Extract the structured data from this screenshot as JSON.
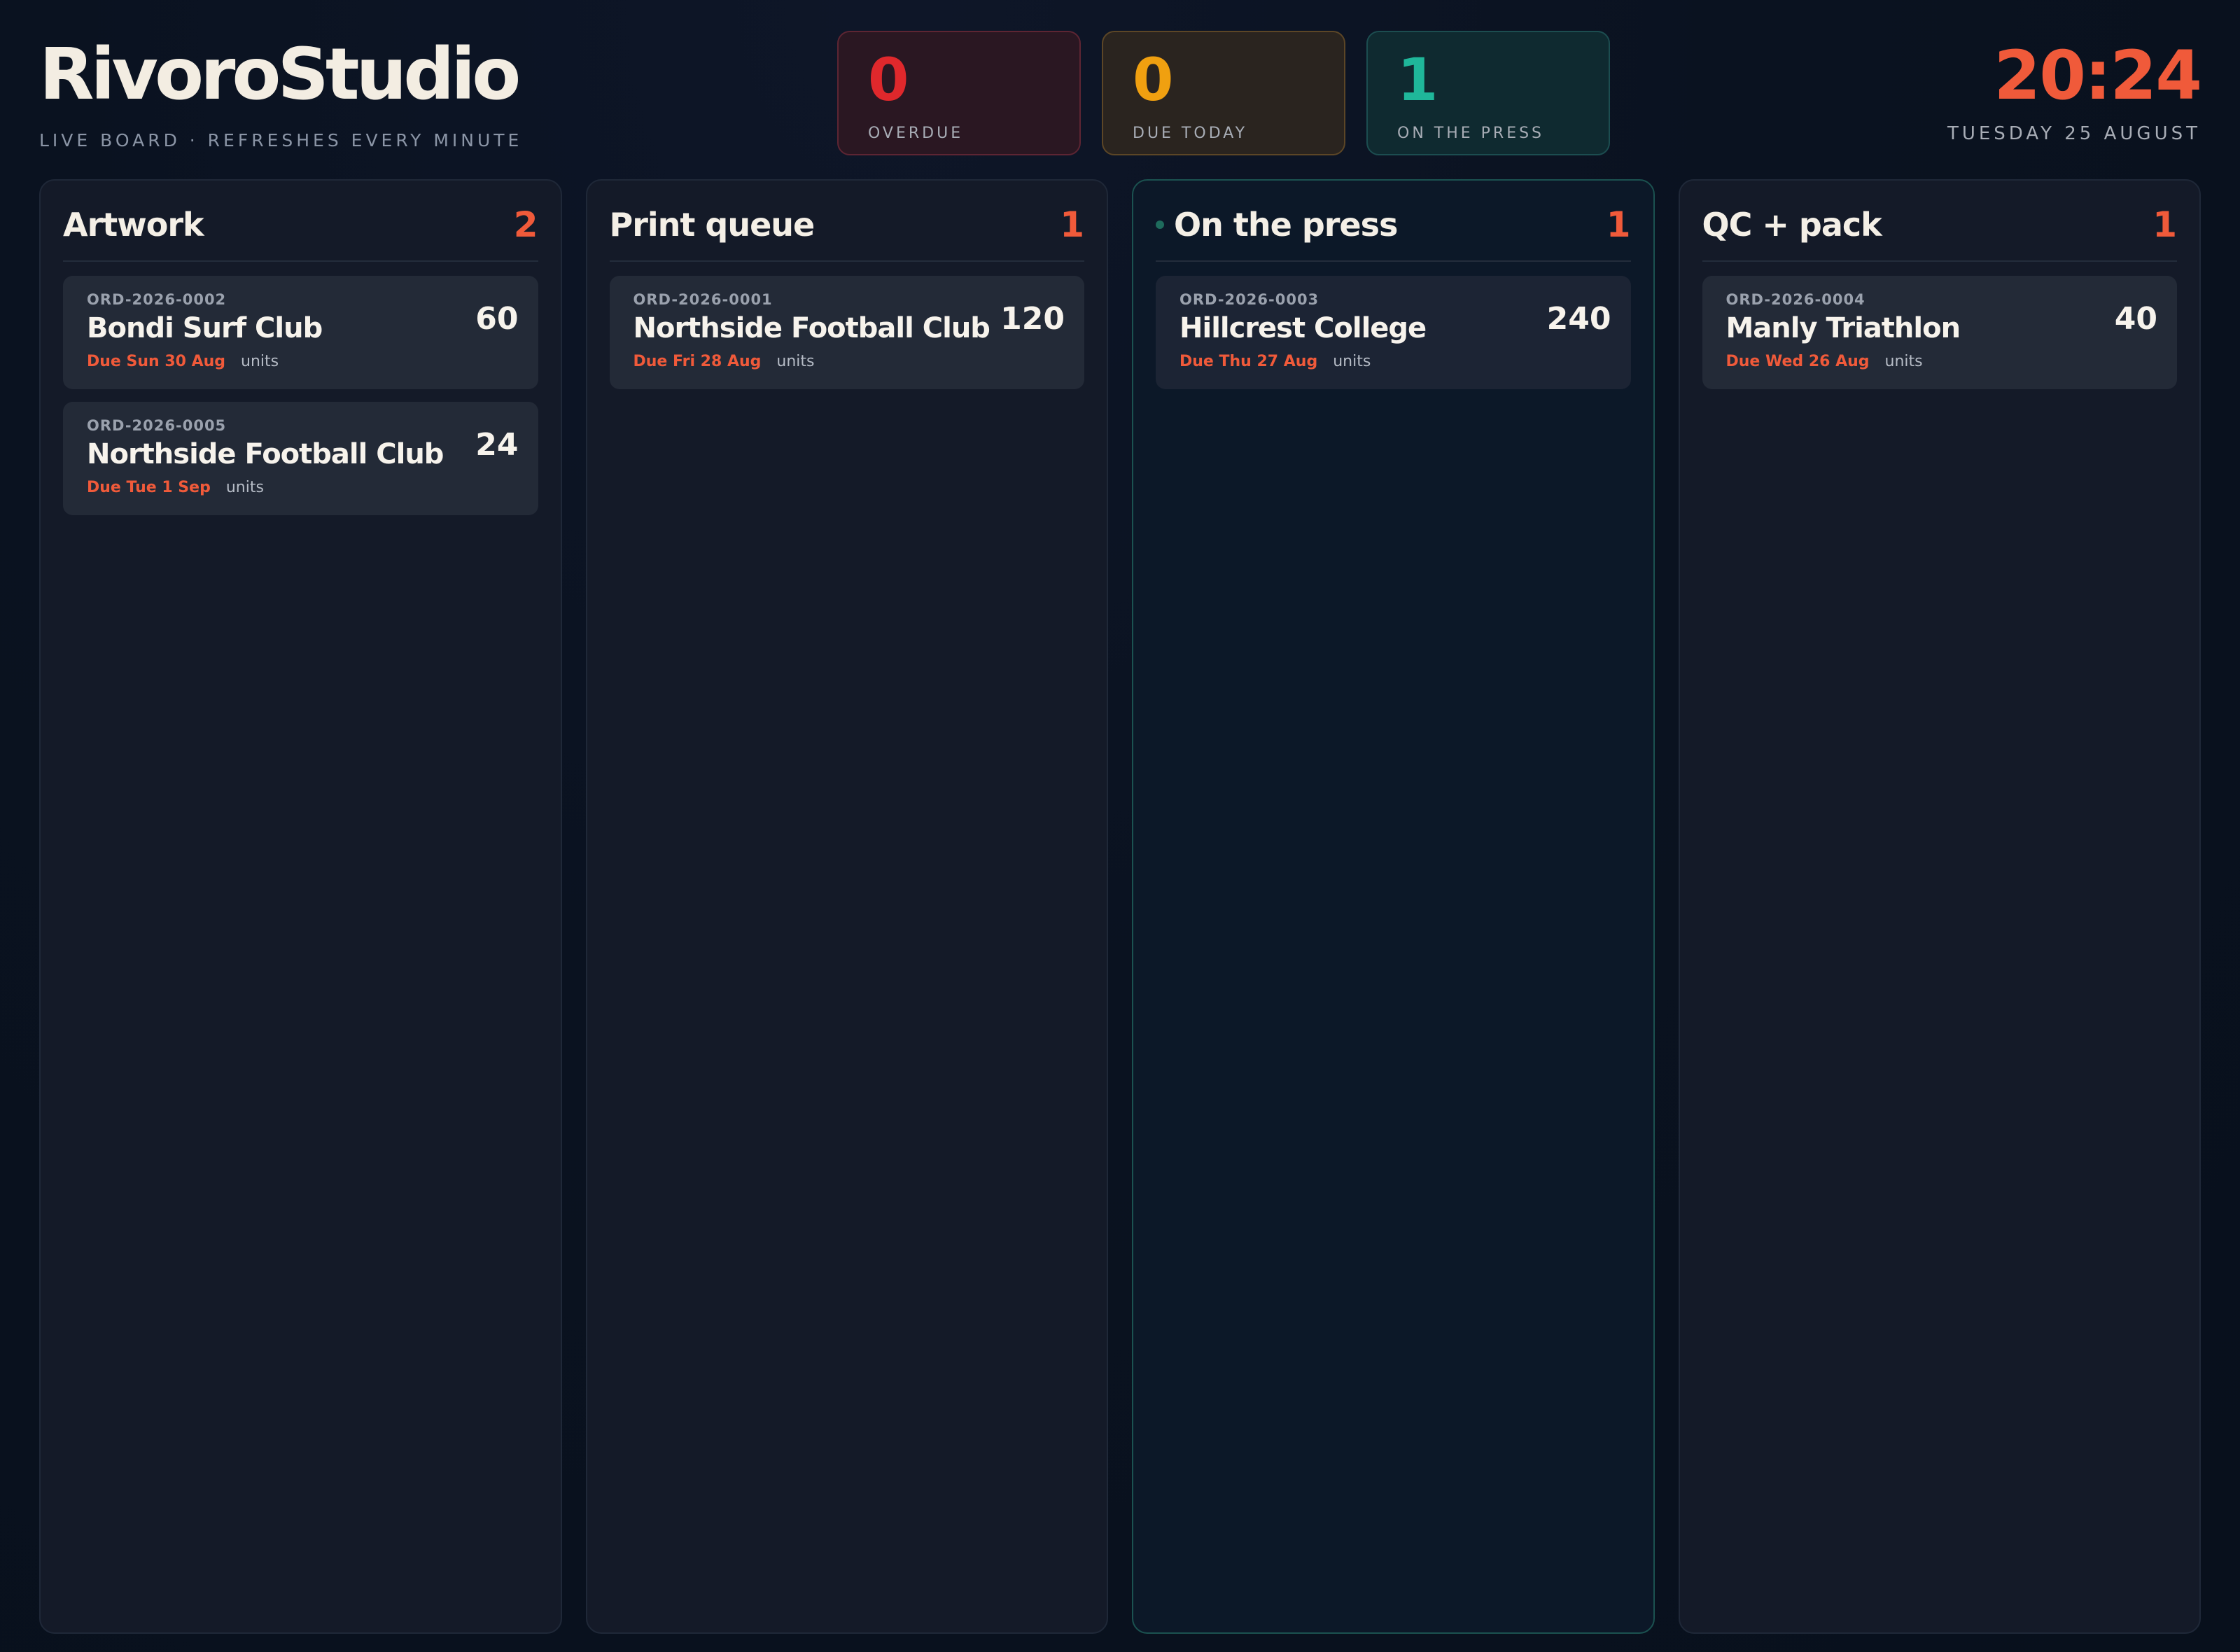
{
  "header": {
    "brand": "RivoroStudio",
    "subtitle": "LIVE BOARD · REFRESHES EVERY MINUTE",
    "clock_time": "20:24",
    "clock_date": "TUESDAY 25 AUGUST"
  },
  "stats": [
    {
      "value": "0",
      "label": "OVERDUE"
    },
    {
      "value": "0",
      "label": "DUE TODAY"
    },
    {
      "value": "1",
      "label": "ON THE PRESS"
    }
  ],
  "columns": [
    {
      "title": "Artwork",
      "count": "2",
      "cards": [
        {
          "id": "ORD-2026-0002",
          "name": "Bondi Surf Club",
          "due": "Due Sun 30 Aug",
          "units_label": "units",
          "qty": "60"
        },
        {
          "id": "ORD-2026-0005",
          "name": "Northside Football Club",
          "due": "Due Tue 1 Sep",
          "units_label": "units",
          "qty": "24"
        }
      ]
    },
    {
      "title": "Print queue",
      "count": "1",
      "cards": [
        {
          "id": "ORD-2026-0001",
          "name": "Northside Football Club",
          "due": "Due Fri 28 Aug",
          "units_label": "units",
          "qty": "120"
        }
      ]
    },
    {
      "title": "On the press",
      "count": "1",
      "cards": [
        {
          "id": "ORD-2026-0003",
          "name": "Hillcrest College",
          "due": "Due Thu 27 Aug",
          "units_label": "units",
          "qty": "240"
        }
      ]
    },
    {
      "title": "QC + pack",
      "count": "1",
      "cards": [
        {
          "id": "ORD-2026-0004",
          "name": "Manly Triathlon",
          "due": "Due Wed 26 Aug",
          "units_label": "units",
          "qty": "40"
        }
      ]
    }
  ],
  "colors": {
    "accent": "#f05a3a",
    "overdue": "#e0282c",
    "due_today": "#f0a010",
    "on_press": "#1fb79a"
  }
}
